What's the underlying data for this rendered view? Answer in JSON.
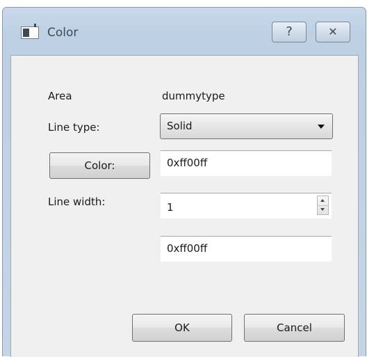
{
  "window": {
    "title": "Color",
    "help_button": "?",
    "close_button": "✕"
  },
  "form": {
    "area_label": "Area",
    "area_value": "dummytype",
    "line_type_label": "Line type:",
    "line_type_selected": "Solid",
    "color_button_label": "Color:",
    "color_value": "0xff00ff",
    "line_width_label": "Line width:",
    "line_width_value": "1",
    "secondary_color_value": "0xff00ff"
  },
  "buttons": {
    "ok": "OK",
    "cancel": "Cancel"
  }
}
